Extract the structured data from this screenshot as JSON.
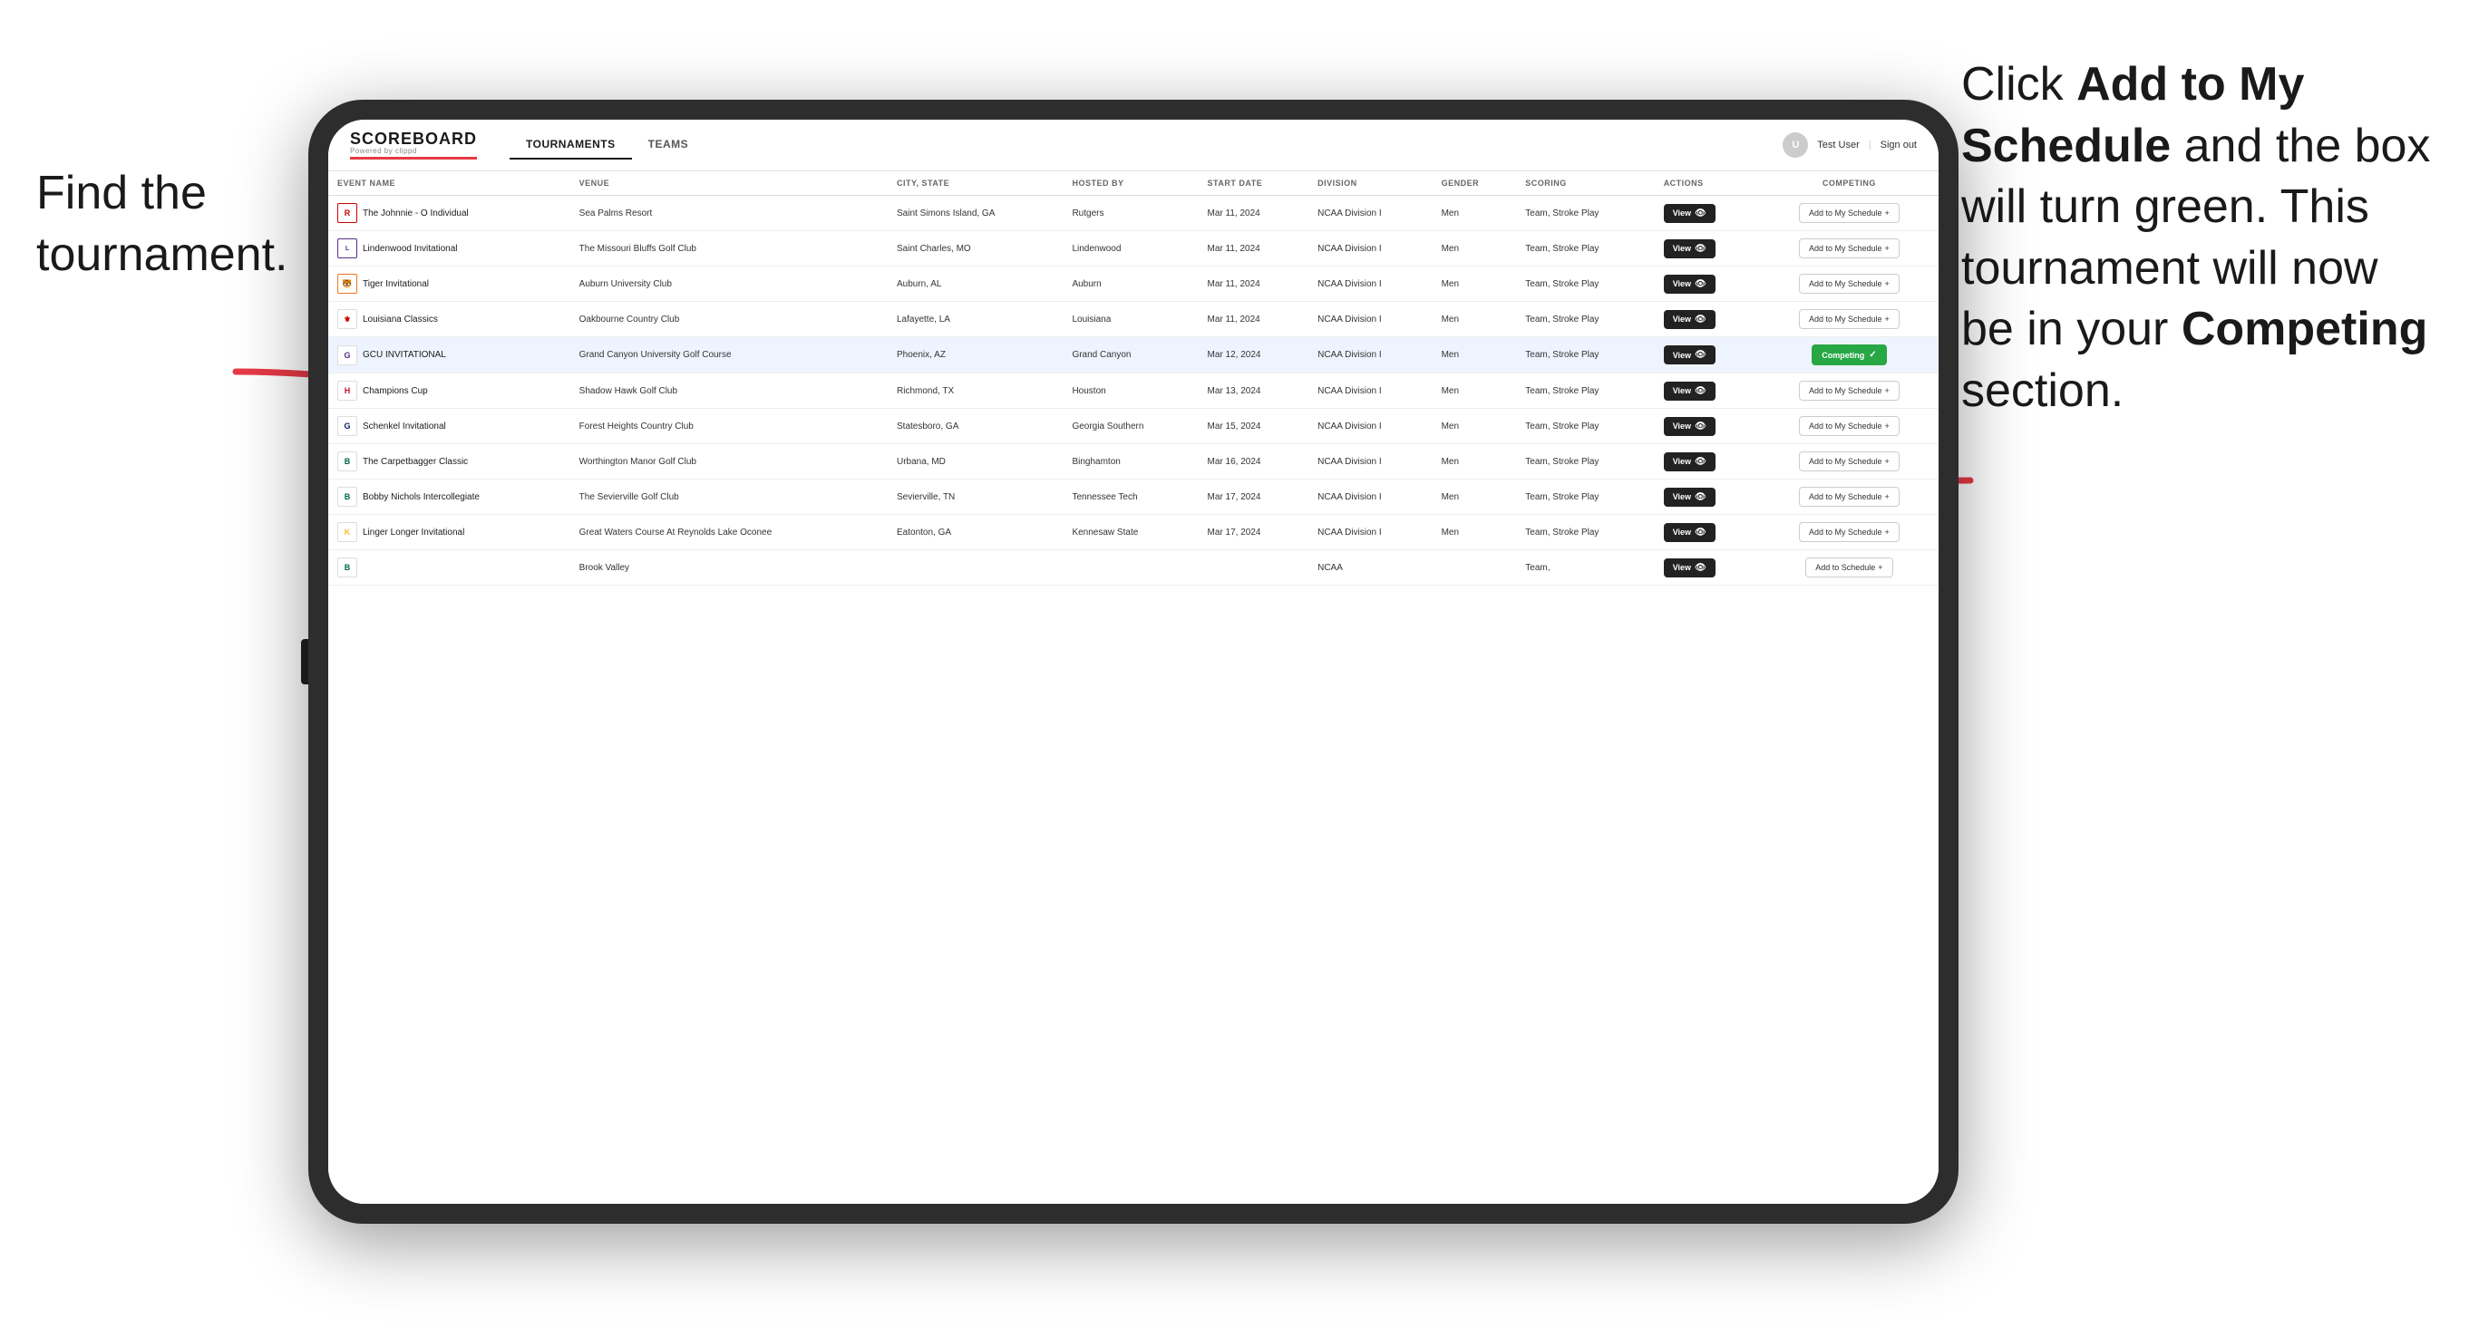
{
  "annotations": {
    "left_title": "Find the tournament.",
    "right_text_prefix": "Click ",
    "right_bold1": "Add to My Schedule",
    "right_text_mid": " and the box will turn green. This tournament will now be in your ",
    "right_bold2": "Competing",
    "right_text_end": " section."
  },
  "navbar": {
    "logo": "SCOREBOARD",
    "logo_sub": "Powered by clippd",
    "tabs": [
      {
        "label": "TOURNAMENTS",
        "active": true
      },
      {
        "label": "TEAMS",
        "active": false
      }
    ],
    "user_text": "Test User",
    "signout": "Sign out"
  },
  "table": {
    "columns": [
      {
        "id": "event_name",
        "label": "EVENT NAME"
      },
      {
        "id": "venue",
        "label": "VENUE"
      },
      {
        "id": "city_state",
        "label": "CITY, STATE"
      },
      {
        "id": "hosted_by",
        "label": "HOSTED BY"
      },
      {
        "id": "start_date",
        "label": "START DATE"
      },
      {
        "id": "division",
        "label": "DIVISION"
      },
      {
        "id": "gender",
        "label": "GENDER"
      },
      {
        "id": "scoring",
        "label": "SCORING"
      },
      {
        "id": "actions",
        "label": "ACTIONS"
      },
      {
        "id": "competing",
        "label": "COMPETING"
      }
    ],
    "rows": [
      {
        "id": 1,
        "logo": "R",
        "logo_class": "logo-r",
        "event_name": "The Johnnie - O Individual",
        "venue": "Sea Palms Resort",
        "city_state": "Saint Simons Island, GA",
        "hosted_by": "Rutgers",
        "start_date": "Mar 11, 2024",
        "division": "NCAA Division I",
        "gender": "Men",
        "scoring": "Team, Stroke Play",
        "view_label": "View",
        "action_label": "Add to My Schedule",
        "is_competing": false,
        "highlighted": false
      },
      {
        "id": 2,
        "logo": "L",
        "logo_class": "logo-l",
        "event_name": "Lindenwood Invitational",
        "venue": "The Missouri Bluffs Golf Club",
        "city_state": "Saint Charles, MO",
        "hosted_by": "Lindenwood",
        "start_date": "Mar 11, 2024",
        "division": "NCAA Division I",
        "gender": "Men",
        "scoring": "Team, Stroke Play",
        "view_label": "View",
        "action_label": "Add to My Schedule",
        "is_competing": false,
        "highlighted": false
      },
      {
        "id": 3,
        "logo": "🐯",
        "logo_class": "logo-tiger",
        "event_name": "Tiger Invitational",
        "venue": "Auburn University Club",
        "city_state": "Auburn, AL",
        "hosted_by": "Auburn",
        "start_date": "Mar 11, 2024",
        "division": "NCAA Division I",
        "gender": "Men",
        "scoring": "Team, Stroke Play",
        "view_label": "View",
        "action_label": "Add to My Schedule",
        "is_competing": false,
        "highlighted": false
      },
      {
        "id": 4,
        "logo": "⚜",
        "logo_class": "logo-la",
        "event_name": "Louisiana Classics",
        "venue": "Oakbourne Country Club",
        "city_state": "Lafayette, LA",
        "hosted_by": "Louisiana",
        "start_date": "Mar 11, 2024",
        "division": "NCAA Division I",
        "gender": "Men",
        "scoring": "Team, Stroke Play",
        "view_label": "View",
        "action_label": "Add to My Schedule",
        "is_competing": false,
        "highlighted": false
      },
      {
        "id": 5,
        "logo": "G",
        "logo_class": "logo-gcu",
        "event_name": "GCU INVITATIONAL",
        "venue": "Grand Canyon University Golf Course",
        "city_state": "Phoenix, AZ",
        "hosted_by": "Grand Canyon",
        "start_date": "Mar 12, 2024",
        "division": "NCAA Division I",
        "gender": "Men",
        "scoring": "Team, Stroke Play",
        "view_label": "View",
        "action_label": "Competing",
        "is_competing": true,
        "highlighted": true
      },
      {
        "id": 6,
        "logo": "H",
        "logo_class": "logo-h",
        "event_name": "Champions Cup",
        "venue": "Shadow Hawk Golf Club",
        "city_state": "Richmond, TX",
        "hosted_by": "Houston",
        "start_date": "Mar 13, 2024",
        "division": "NCAA Division I",
        "gender": "Men",
        "scoring": "Team, Stroke Play",
        "view_label": "View",
        "action_label": "Add to My Schedule",
        "is_competing": false,
        "highlighted": false
      },
      {
        "id": 7,
        "logo": "G",
        "logo_class": "logo-gs",
        "event_name": "Schenkel Invitational",
        "venue": "Forest Heights Country Club",
        "city_state": "Statesboro, GA",
        "hosted_by": "Georgia Southern",
        "start_date": "Mar 15, 2024",
        "division": "NCAA Division I",
        "gender": "Men",
        "scoring": "Team, Stroke Play",
        "view_label": "View",
        "action_label": "Add to My Schedule",
        "is_competing": false,
        "highlighted": false
      },
      {
        "id": 8,
        "logo": "B",
        "logo_class": "logo-b",
        "event_name": "The Carpetbagger Classic",
        "venue": "Worthington Manor Golf Club",
        "city_state": "Urbana, MD",
        "hosted_by": "Binghamton",
        "start_date": "Mar 16, 2024",
        "division": "NCAA Division I",
        "gender": "Men",
        "scoring": "Team, Stroke Play",
        "view_label": "View",
        "action_label": "Add to My Schedule",
        "is_competing": false,
        "highlighted": false
      },
      {
        "id": 9,
        "logo": "B",
        "logo_class": "logo-b",
        "event_name": "Bobby Nichols Intercollegiate",
        "venue": "The Sevierville Golf Club",
        "city_state": "Sevierville, TN",
        "hosted_by": "Tennessee Tech",
        "start_date": "Mar 17, 2024",
        "division": "NCAA Division I",
        "gender": "Men",
        "scoring": "Team, Stroke Play",
        "view_label": "View",
        "action_label": "Add to My Schedule",
        "is_competing": false,
        "highlighted": false
      },
      {
        "id": 10,
        "logo": "K",
        "logo_class": "logo-k",
        "event_name": "Linger Longer Invitational",
        "venue": "Great Waters Course At Reynolds Lake Oconee",
        "city_state": "Eatonton, GA",
        "hosted_by": "Kennesaw State",
        "start_date": "Mar 17, 2024",
        "division": "NCAA Division I",
        "gender": "Men",
        "scoring": "Team, Stroke Play",
        "view_label": "View",
        "action_label": "Add to My Schedule",
        "is_competing": false,
        "highlighted": false
      },
      {
        "id": 11,
        "logo": "B",
        "logo_class": "logo-b",
        "event_name": "",
        "venue": "Brook Valley",
        "city_state": "",
        "hosted_by": "",
        "start_date": "",
        "division": "NCAA",
        "gender": "",
        "scoring": "Team,",
        "view_label": "View",
        "action_label": "Add to Schedule",
        "is_competing": false,
        "highlighted": false
      }
    ]
  }
}
